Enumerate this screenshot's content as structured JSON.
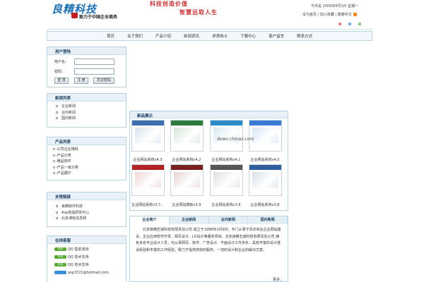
{
  "header": {
    "logo_text": "良精科技",
    "logo_sub": "致力于中国企业商务",
    "slogan1": "科技创造价值",
    "slogan2": "智慧远取人生",
    "date": "今天是  2009年6月1日  星期一",
    "links": [
      "设为首页",
      "加入收藏",
      "繁體中文"
    ],
    "swatch_colors": [
      "#e58a8a",
      "#7fb0e0",
      "#8ccf7a"
    ]
  },
  "nav": {
    "items": [
      "首页",
      "关于我们",
      "产品介绍",
      "新闻资讯",
      "求贤纳士",
      "下载中心",
      "客户留言",
      "联系方式"
    ]
  },
  "login": {
    "title": "用户登陆",
    "username_label": "用户名：",
    "password_label": "密码：",
    "buttons": [
      "登 陆",
      "注 册",
      "忘记密码"
    ]
  },
  "news": {
    "title": "新闻列表",
    "items": [
      "企业新闻",
      "业内新闻",
      "国内新闻"
    ]
  },
  "products_list": {
    "title": "产品列表",
    "items": [
      "-公司企业博码",
      "-产品分类",
      "-精品软件",
      "-产品一级分类",
      "-产品展厅"
    ]
  },
  "links_box": {
    "title": "友情链接",
    "items": [
      "良精软件科技",
      "Asp技能研究中心",
      "北京课班信息网"
    ]
  },
  "support": {
    "title": "在线客服",
    "qq_badge": "在线",
    "items": [
      "QQ 售前咨询",
      "QQ 技术支持",
      "QQ 技术支持"
    ],
    "email": "asp3721@hotmail.com"
  },
  "showcase": {
    "title": "新品展示",
    "watermark": "down.chinaz.com",
    "products": [
      {
        "caption": "企业网站系统v4.3",
        "color": "#3b6fb0"
      },
      {
        "caption": "企业网站系统v4.2",
        "color": "#2e7a3c"
      },
      {
        "caption": "企业网站系统v4.1",
        "color": "#2c8ac8"
      },
      {
        "caption": "企业网站系统v4.0",
        "color": "#3a7bd5"
      },
      {
        "caption": "企业网站系统v3.7...",
        "color": "#b22222"
      },
      {
        "caption": "企业网站模板v3.9",
        "color": "#7a2020"
      },
      {
        "caption": "企业网站系统v3.8",
        "color": "#555555"
      },
      {
        "caption": "企业网站系统v3.8",
        "color": "#2f5f9e"
      }
    ]
  },
  "tabs": {
    "items": [
      "企业简介",
      "企业新闻",
      "业内新闻",
      "国内新闻"
    ],
    "active_index": 0,
    "body": "北京良精志诚科技有限责任公司 成立于1998年2月9日，专门从事于青年商业企业网站建设、企业应用软件开发、网页设计、LO设计等服务项目。北京良精志诚科技有限责任公司 拥有多名专业设计人员，均从事网页、软件、广告设计、平面设计工作多年，具有丰富的设计建设经验和丰富的工作经验，致力于提供高效的服务、一流的设计和企业的解决方案。",
    "more": "更多..."
  }
}
